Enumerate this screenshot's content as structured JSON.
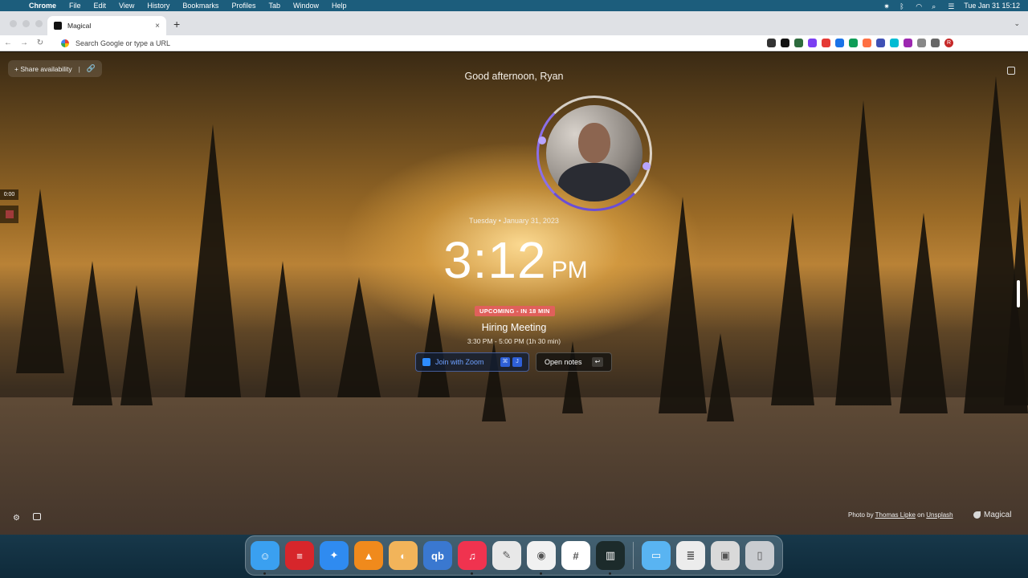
{
  "menubar": {
    "app_name": "Chrome",
    "menus": [
      "File",
      "Edit",
      "View",
      "History",
      "Bookmarks",
      "Profiles",
      "Tab",
      "Window",
      "Help"
    ],
    "clock": "Tue Jan 31  15:12"
  },
  "browser": {
    "tab_title": "Magical",
    "tab_close": "×",
    "new_tab": "+",
    "omnibox_placeholder": "Search Google or type a URL",
    "profile_initial": "R",
    "extension_colors": [
      "#333333",
      "#111111",
      "#2d6b3d",
      "#7b3ff2",
      "#e53935",
      "#1a73e8",
      "#0f9d58",
      "#ff7043",
      "#3f51b5",
      "#00bcd4",
      "#9c27b0",
      "#888888",
      "#666666"
    ]
  },
  "page": {
    "share_label": "+ Share availability",
    "share_sep": "|",
    "greeting": "Good afternoon, Ryan",
    "date": "Tuesday • January 31, 2023",
    "time": "3:12",
    "ampm": "PM",
    "upcoming_badge": "UPCOMING - IN 18 MIN",
    "meeting_title": "Hiring Meeting",
    "meeting_time": "3:30 PM - 5:00 PM (1h 30 min)",
    "zoom_button": "Join with Zoom",
    "zoom_keys": [
      "⌘",
      "J"
    ],
    "notes_button": "Open notes",
    "notes_key": "↩",
    "recording_timer": "0:00",
    "photo_credit_prefix": "Photo by",
    "photo_author": "Thomas Lipke",
    "photo_on": "on",
    "photo_site": "Unsplash",
    "brand": "Magical"
  },
  "dock": {
    "apps": [
      {
        "name": "finder",
        "color": "#3aa0f0",
        "glyph": "☺",
        "running": true
      },
      {
        "name": "expressvpn",
        "color": "#d7262b",
        "glyph": "≡",
        "running": false
      },
      {
        "name": "safari",
        "color": "#2f8bf0",
        "glyph": "✦",
        "running": false
      },
      {
        "name": "vlc",
        "color": "#f08a1c",
        "glyph": "▲",
        "running": false
      },
      {
        "name": "weather",
        "color": "#f2b45a",
        "glyph": "◐",
        "running": false
      },
      {
        "name": "qbittorrent",
        "color": "#3a78d0",
        "glyph": "qb",
        "running": false
      },
      {
        "name": "music",
        "color": "#f0334f",
        "glyph": "♫",
        "running": true
      },
      {
        "name": "textedit",
        "color": "#e8e8e8",
        "glyph": "✎",
        "running": false
      },
      {
        "name": "chrome",
        "color": "#f1f1f1",
        "glyph": "◉",
        "running": true
      },
      {
        "name": "slack",
        "color": "#ffffff",
        "glyph": "#",
        "running": false
      },
      {
        "name": "magical",
        "color": "#1c2b2b",
        "glyph": "▥",
        "running": true
      }
    ],
    "docs": [
      {
        "name": "folder",
        "color": "#59b4f2",
        "glyph": "▭"
      },
      {
        "name": "document",
        "color": "#ececec",
        "glyph": "≣"
      },
      {
        "name": "screenshot",
        "color": "#d9d9d9",
        "glyph": "▣"
      },
      {
        "name": "trash",
        "color": "#c9ccd0",
        "glyph": "▯"
      }
    ]
  }
}
